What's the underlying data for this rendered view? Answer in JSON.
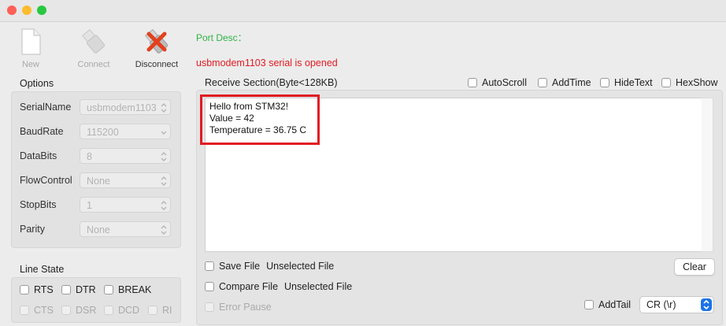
{
  "toolbar": {
    "new_label": "New",
    "connect_label": "Connect",
    "disconnect_label": "Disconnect"
  },
  "status": {
    "port_desc": "Port Desc：",
    "message": "usbmodem1103 serial is opened",
    "port_desc_color": "#2fb344",
    "message_color": "#e11b22"
  },
  "options": {
    "title": "Options",
    "rows": [
      {
        "label": "SerialName",
        "value": "usbmodem1103"
      },
      {
        "label": "BaudRate",
        "value": "115200"
      },
      {
        "label": "DataBits",
        "value": "8"
      },
      {
        "label": "FlowControl",
        "value": "None"
      },
      {
        "label": "StopBits",
        "value": "1"
      },
      {
        "label": "Parity",
        "value": "None"
      }
    ]
  },
  "line_state": {
    "title": "Line State",
    "controls": [
      "RTS",
      "DTR",
      "BREAK"
    ],
    "indicators": [
      "CTS",
      "DSR",
      "DCD",
      "RI"
    ]
  },
  "receive": {
    "title": "Receive Section(Byte<128KB)",
    "autoscroll": "AutoScroll",
    "addtime": "AddTime",
    "hidetext": "HideText",
    "hexshow": "HexShow",
    "text": "Hello from STM32!\nValue = 42\nTemperature = 36.75 C"
  },
  "file": {
    "save_label": "Save File",
    "save_value": "Unselected File",
    "compare_label": "Compare File",
    "compare_value": "Unselected File",
    "error_pause": "Error Pause"
  },
  "actions": {
    "clear": "Clear",
    "addtail": "AddTail",
    "tail_value": "CR (\\r)"
  }
}
